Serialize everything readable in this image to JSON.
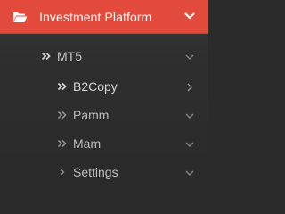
{
  "header": {
    "title": "Investment Platform",
    "icon": "folder-open-icon",
    "expand_icon": "chevron-down-icon",
    "accent_color": "#e24a3b"
  },
  "submenu": {
    "items": [
      {
        "label": "MT5",
        "lead_icon": "double-chevron-right-icon",
        "trail_icon": "chevron-down-icon"
      },
      {
        "label": "B2Copy",
        "lead_icon": "double-chevron-right-icon",
        "trail_icon": "chevron-right-icon"
      },
      {
        "label": "Pamm",
        "lead_icon": "double-chevron-right-icon",
        "trail_icon": "chevron-down-icon"
      },
      {
        "label": "Mam",
        "lead_icon": "double-chevron-right-icon",
        "trail_icon": "chevron-down-icon"
      },
      {
        "label": "Settings",
        "lead_icon": "chevron-right-icon",
        "trail_icon": "chevron-down-icon"
      }
    ]
  }
}
